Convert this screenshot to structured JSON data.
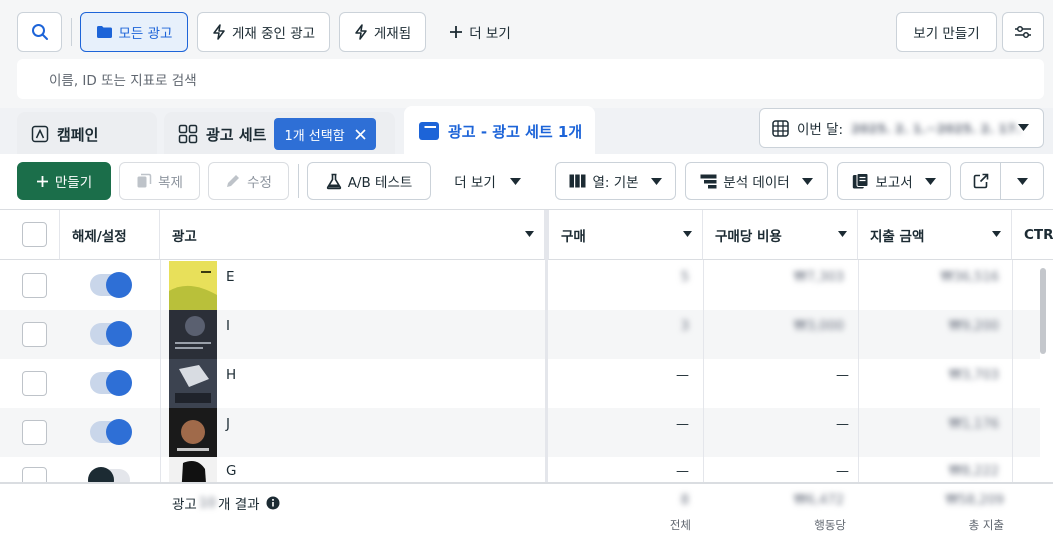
{
  "top_bar": {
    "all_ads_label": "모든 광고",
    "active_ads_label": "게재 중인 광고",
    "published_label": "게재됨",
    "more_label": "더 보기",
    "create_view_label": "보기 만들기",
    "search_placeholder": "이름, ID 또는 지표로 검색"
  },
  "tabs": {
    "campaign": "캠페인",
    "ad_sets": "광고 세트",
    "selected_badge": "1개 선택함",
    "ads": "광고 - 광고 세트 1개"
  },
  "date_range": {
    "label": "이번 달:",
    "value": "2025. 2. 1.~2025. 2. 17."
  },
  "toolbar": {
    "create": "만들기",
    "duplicate": "복제",
    "edit": "수정",
    "ab_test": "A/B 테스트",
    "more": "더 보기",
    "columns": "열: 기본",
    "breakdown": "분석 데이터",
    "reports": "보고서"
  },
  "table": {
    "headers": {
      "onoff": "해제/설정",
      "ad": "광고",
      "purchases": "구매",
      "cost_per_purchase": "구매당 비용",
      "amount_spent": "지출 금액",
      "ctr": "CTR"
    },
    "rows": [
      {
        "name": "E",
        "on": true,
        "purchases": "5",
        "cpp": "₩7,303",
        "spend": "₩36,516"
      },
      {
        "name": "I",
        "on": true,
        "purchases": "3",
        "cpp": "₩3,000",
        "spend": "₩9,200"
      },
      {
        "name": "H",
        "on": true,
        "purchases": "—",
        "cpp": "—",
        "spend": "₩3,703"
      },
      {
        "name": "J",
        "on": true,
        "purchases": "—",
        "cpp": "—",
        "spend": "₩1,176"
      },
      {
        "name": "G",
        "on": false,
        "purchases": "—",
        "cpp": "—",
        "spend": "₩8,222"
      }
    ],
    "summary": {
      "label_prefix": "광고",
      "count": "10",
      "label_suffix": "개 결과",
      "purchases": "8",
      "purchases_sub": "전체",
      "cpp": "₩6,472",
      "cpp_sub": "행동당",
      "spend": "₩58,209",
      "spend_sub": "총 지출"
    }
  },
  "colors": {
    "accent": "#1d64d8",
    "create_button": "#1b6e4a",
    "toggle_on": "#2e6fd6"
  }
}
